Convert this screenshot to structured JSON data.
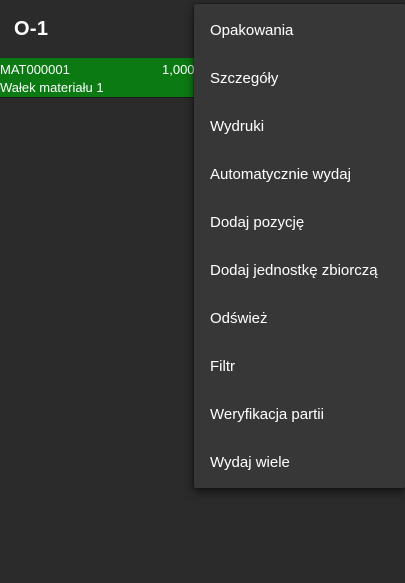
{
  "header": {
    "title": "O-1"
  },
  "list": {
    "rows": [
      {
        "code": "MAT000001",
        "quantity": "1,000",
        "name": "Wałek materiału 1",
        "highlight_color": "#0b7a12"
      }
    ]
  },
  "menu": {
    "items": [
      {
        "label": "Opakowania"
      },
      {
        "label": "Szczegóły"
      },
      {
        "label": "Wydruki"
      },
      {
        "label": "Automatycznie wydaj"
      },
      {
        "label": "Dodaj pozycję"
      },
      {
        "label": "Dodaj jednostkę zbiorczą"
      },
      {
        "label": "Odśwież"
      },
      {
        "label": "Filtr"
      },
      {
        "label": "Weryfikacja partii"
      },
      {
        "label": "Wydaj wiele"
      }
    ]
  },
  "colors": {
    "background": "#2b2b2b",
    "menu_background": "#373737",
    "selected_row": "#0b7a12",
    "text": "#ffffff"
  }
}
